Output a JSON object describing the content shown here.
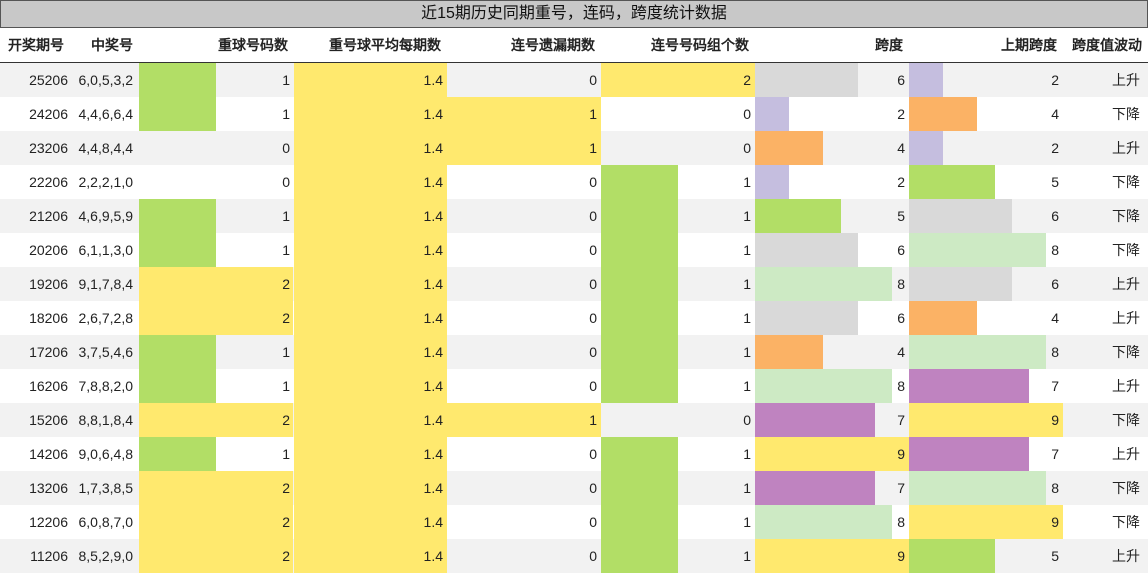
{
  "title": "近15期历史同期重号，连码，跨度统计数据",
  "headers": [
    "开奖期号",
    "中奖号",
    "重球号码数",
    "重号球平均每期数",
    "连号遗漏期数",
    "连号号码组个数",
    "跨度",
    "上期跨度",
    "跨度值波动"
  ],
  "colors": {
    "yellow": "#ffe96e",
    "green": "#b2de66",
    "gray": "#d9d9d9",
    "light_green": "#cdeac4",
    "lavender": "#c5bedf",
    "orange": "#fbb265",
    "purple": "#bf83c0"
  },
  "rows": [
    {
      "issue": "25206",
      "numbers": "6,0,5,3,2",
      "repeat": "1",
      "avg": "1.4",
      "consec_miss": "0",
      "consec_groups": "2",
      "span": "6",
      "prev_span": "2",
      "wave": "上升"
    },
    {
      "issue": "24206",
      "numbers": "4,4,6,6,4",
      "repeat": "1",
      "avg": "1.4",
      "consec_miss": "1",
      "consec_groups": "0",
      "span": "2",
      "prev_span": "4",
      "wave": "下降"
    },
    {
      "issue": "23206",
      "numbers": "4,4,8,4,4",
      "repeat": "0",
      "avg": "1.4",
      "consec_miss": "1",
      "consec_groups": "0",
      "span": "4",
      "prev_span": "2",
      "wave": "上升"
    },
    {
      "issue": "22206",
      "numbers": "2,2,2,1,0",
      "repeat": "0",
      "avg": "1.4",
      "consec_miss": "0",
      "consec_groups": "1",
      "span": "2",
      "prev_span": "5",
      "wave": "下降"
    },
    {
      "issue": "21206",
      "numbers": "4,6,9,5,9",
      "repeat": "1",
      "avg": "1.4",
      "consec_miss": "0",
      "consec_groups": "1",
      "span": "5",
      "prev_span": "6",
      "wave": "下降"
    },
    {
      "issue": "20206",
      "numbers": "6,1,1,3,0",
      "repeat": "1",
      "avg": "1.4",
      "consec_miss": "0",
      "consec_groups": "1",
      "span": "6",
      "prev_span": "8",
      "wave": "下降"
    },
    {
      "issue": "19206",
      "numbers": "9,1,7,8,4",
      "repeat": "2",
      "avg": "1.4",
      "consec_miss": "0",
      "consec_groups": "1",
      "span": "8",
      "prev_span": "6",
      "wave": "上升"
    },
    {
      "issue": "18206",
      "numbers": "2,6,7,2,8",
      "repeat": "2",
      "avg": "1.4",
      "consec_miss": "0",
      "consec_groups": "1",
      "span": "6",
      "prev_span": "4",
      "wave": "上升"
    },
    {
      "issue": "17206",
      "numbers": "3,7,5,4,6",
      "repeat": "1",
      "avg": "1.4",
      "consec_miss": "0",
      "consec_groups": "1",
      "span": "4",
      "prev_span": "8",
      "wave": "下降"
    },
    {
      "issue": "16206",
      "numbers": "7,8,8,2,0",
      "repeat": "1",
      "avg": "1.4",
      "consec_miss": "0",
      "consec_groups": "1",
      "span": "8",
      "prev_span": "7",
      "wave": "上升"
    },
    {
      "issue": "15206",
      "numbers": "8,8,1,8,4",
      "repeat": "2",
      "avg": "1.4",
      "consec_miss": "1",
      "consec_groups": "0",
      "span": "7",
      "prev_span": "9",
      "wave": "下降"
    },
    {
      "issue": "14206",
      "numbers": "9,0,6,4,8",
      "repeat": "1",
      "avg": "1.4",
      "consec_miss": "0",
      "consec_groups": "1",
      "span": "9",
      "prev_span": "7",
      "wave": "上升"
    },
    {
      "issue": "13206",
      "numbers": "1,7,3,8,5",
      "repeat": "2",
      "avg": "1.4",
      "consec_miss": "0",
      "consec_groups": "1",
      "span": "7",
      "prev_span": "8",
      "wave": "下降"
    },
    {
      "issue": "12206",
      "numbers": "6,0,8,7,0",
      "repeat": "2",
      "avg": "1.4",
      "consec_miss": "0",
      "consec_groups": "1",
      "span": "8",
      "prev_span": "9",
      "wave": "下降"
    },
    {
      "issue": "11206",
      "numbers": "8,5,2,9,0",
      "repeat": "2",
      "avg": "1.4",
      "consec_miss": "0",
      "consec_groups": "1",
      "span": "9",
      "prev_span": "5",
      "wave": "上升"
    }
  ]
}
